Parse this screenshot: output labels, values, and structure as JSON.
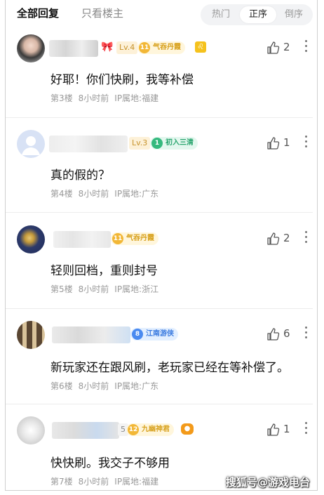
{
  "tabs": {
    "all_replies": "全部回复",
    "only_op": "只看楼主"
  },
  "sort": {
    "hot": "热门",
    "asc": "正序",
    "desc": "倒序"
  },
  "comments": [
    {
      "level": "Lv.4",
      "tag_num": "11",
      "tag": "气吞丹霞",
      "text": "好耶！你们快刷，我等补偿",
      "floor": "第3楼",
      "time": "8小时前",
      "ip": "IP属地:福建",
      "likes": "2"
    },
    {
      "level": "Lv.3",
      "tag_num": "1",
      "tag": "初入三清",
      "text": "真的假的？",
      "floor": "第4楼",
      "time": "8小时前",
      "ip": "IP属地:广东",
      "likes": "1"
    },
    {
      "level": "",
      "tag_num": "11",
      "tag": "气吞丹霞",
      "text": "轻则回档，重则封号",
      "floor": "第5楼",
      "time": "8小时前",
      "ip": "IP属地:浙江",
      "likes": "2"
    },
    {
      "level": "",
      "tag_num": "8",
      "tag": "江南游侠",
      "text": "新玩家还在跟风刷，老玩家已经在等补偿了。",
      "floor": "第6楼",
      "time": "8小时前",
      "ip": "IP属地:广东",
      "likes": "6"
    },
    {
      "level": "5",
      "tag_num": "12",
      "tag": "九幽神君",
      "text": "快快刷。我交子不够用",
      "floor": "第7楼",
      "time": "8小时前",
      "ip": "IP属地:福建",
      "likes": "1"
    }
  ],
  "watermark": "搜狐号@游戏电台",
  "colors": {
    "like_icon": "#555555",
    "meta_text": "#999999",
    "divider": "#ececec"
  }
}
